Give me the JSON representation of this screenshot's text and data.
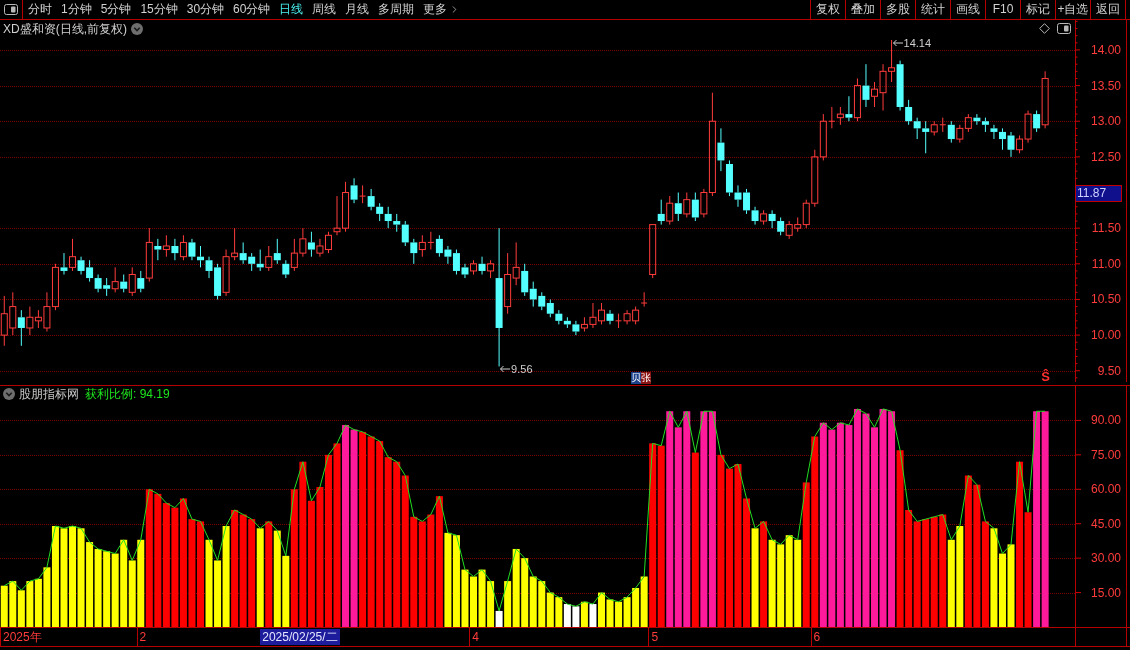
{
  "toolbar": {
    "periods": [
      {
        "label": "分时",
        "selected": false
      },
      {
        "label": "1分钟",
        "selected": false
      },
      {
        "label": "5分钟",
        "selected": false
      },
      {
        "label": "15分钟",
        "selected": false
      },
      {
        "label": "30分钟",
        "selected": false
      },
      {
        "label": "60分钟",
        "selected": false
      },
      {
        "label": "日线",
        "selected": true
      },
      {
        "label": "周线",
        "selected": false
      },
      {
        "label": "月线",
        "selected": false
      },
      {
        "label": "多周期",
        "selected": false
      }
    ],
    "more": "更多",
    "actions": [
      "复权",
      "叠加",
      "多股",
      "统计",
      "画线",
      "F10",
      "标记",
      "+自选",
      "返回"
    ]
  },
  "price_chart": {
    "title": "XD盛和资(日线,前复权)",
    "high_label": "14.14",
    "low_label": "9.56",
    "axis_labels": [
      "14.00",
      "13.50",
      "13.00",
      "12.50",
      "11.50",
      "11.00",
      "10.50",
      "10.00",
      "9.50"
    ],
    "cursor_price": "11.87",
    "signals": [
      {
        "kind": "badge",
        "label": "贝",
        "color": "#1c428c"
      },
      {
        "kind": "badge",
        "label": "张",
        "color": "#8c1414"
      },
      {
        "kind": "mark",
        "label": "Ŝ",
        "color": "#ff3030"
      }
    ]
  },
  "indicator": {
    "name": "股朋指标网",
    "legend": "获利比例: 94.19",
    "chart_data": {
      "type": "bar",
      "ylim": [
        0,
        105
      ],
      "grid": true,
      "yticks": [
        {
          "value": 90,
          "label": "90.00"
        },
        {
          "value": 75,
          "label": "75.00"
        },
        {
          "value": 60,
          "label": "60.00"
        },
        {
          "value": 45,
          "label": "45.00"
        },
        {
          "value": 30,
          "label": "30.00"
        },
        {
          "value": 15,
          "label": "15.00"
        }
      ],
      "values": [
        18,
        20,
        16,
        20,
        21,
        26,
        44,
        43,
        44,
        43,
        37,
        34,
        33,
        32,
        38,
        29,
        38,
        60,
        58,
        54,
        52,
        56,
        47,
        46,
        38,
        29,
        44,
        51,
        49,
        47,
        43,
        46,
        42,
        31,
        60,
        72,
        55,
        61,
        75,
        80,
        88,
        86,
        85,
        83,
        81,
        74,
        72,
        66,
        48,
        46,
        49,
        57,
        41,
        40,
        25,
        22,
        25,
        20,
        7,
        20,
        34,
        30,
        22,
        20,
        15,
        13,
        10,
        9,
        11,
        10,
        15,
        12,
        11,
        13,
        17,
        22,
        80,
        79,
        94,
        87,
        94,
        76,
        94,
        94,
        75,
        69,
        71,
        56,
        43,
        46,
        38,
        36,
        40,
        38,
        63,
        83,
        89,
        86,
        89,
        88,
        95,
        93,
        87,
        95,
        94,
        77,
        51,
        46,
        47,
        48,
        49,
        38,
        44,
        66,
        62,
        46,
        43,
        32,
        36,
        72,
        50,
        94,
        94,
        null,
        null,
        null
      ]
    }
  },
  "date_axis": {
    "labels": [
      "2025年",
      "2",
      "4",
      "5",
      "6"
    ],
    "cursor": "2025/02/25/二"
  }
}
